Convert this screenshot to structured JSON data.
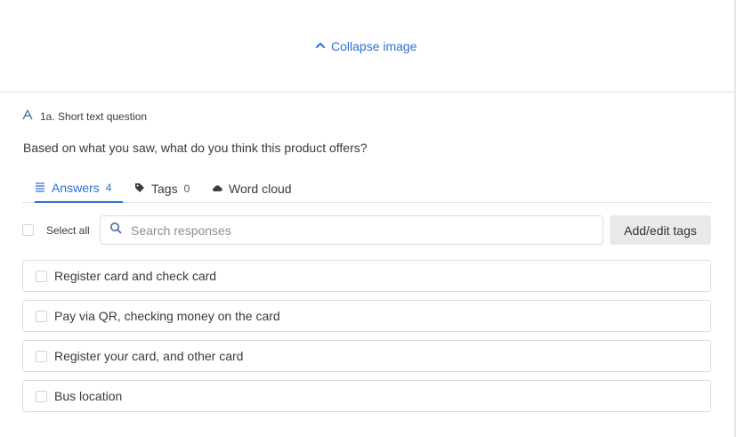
{
  "collapse": {
    "label": "Collapse image",
    "icon": "chevron-up-icon"
  },
  "question": {
    "type_label": "1a. Short text question",
    "type_icon": "text-type-icon",
    "text": "Based on what you saw, what do you think this product offers?"
  },
  "tabs": [
    {
      "label": "Answers",
      "count": "4",
      "icon": "list-icon",
      "active": true
    },
    {
      "label": "Tags",
      "count": "0",
      "icon": "tag-icon",
      "active": false
    },
    {
      "label": "Word cloud",
      "count": "",
      "icon": "cloud-icon",
      "active": false
    }
  ],
  "toolbar": {
    "select_all_label": "Select all",
    "search_placeholder": "Search responses",
    "search_value": "",
    "tags_button_label": "Add/edit tags"
  },
  "responses": [
    {
      "text": "Register card and check card"
    },
    {
      "text": "Pay via QR, checking money on the card"
    },
    {
      "text": "Register your card, and other card"
    },
    {
      "text": "Bus location"
    }
  ],
  "colors": {
    "accent": "#2f6fd6",
    "border": "#dcdce0",
    "button_bg": "#e9e9ec",
    "text": "#3a3a3a"
  }
}
